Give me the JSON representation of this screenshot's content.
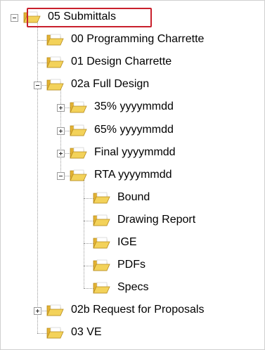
{
  "tree": {
    "root": {
      "label": "05 Submittals",
      "expanded": true,
      "selected": true,
      "highlight_color": "#c8202c",
      "children": [
        {
          "label": "00 Programming Charrette"
        },
        {
          "label": "01 Design Charrette"
        },
        {
          "label": "02a Full Design",
          "expanded": true,
          "children": [
            {
              "label": "35% yyyymmdd",
              "expanded": false
            },
            {
              "label": "65% yyyymmdd",
              "expanded": false
            },
            {
              "label": "Final yyyymmdd",
              "expanded": false
            },
            {
              "label": "RTA yyyymmdd",
              "expanded": true,
              "children": [
                {
                  "label": "Bound"
                },
                {
                  "label": "Drawing Report"
                },
                {
                  "label": "IGE"
                },
                {
                  "label": "PDFs"
                },
                {
                  "label": "Specs"
                }
              ]
            }
          ]
        },
        {
          "label": "02b Request for Proposals",
          "expanded": false
        },
        {
          "label": "03 VE"
        }
      ]
    }
  },
  "icons": {
    "folder": "folder-icon",
    "expander_plus": "expand-plus-icon",
    "expander_minus": "collapse-minus-icon"
  },
  "colors": {
    "folder_front": "#f3d25a",
    "folder_back": "#e3b233",
    "folder_stroke": "#b58a1c",
    "folder_paper": "#ffffff",
    "tree_line": "#9a9a9a"
  }
}
